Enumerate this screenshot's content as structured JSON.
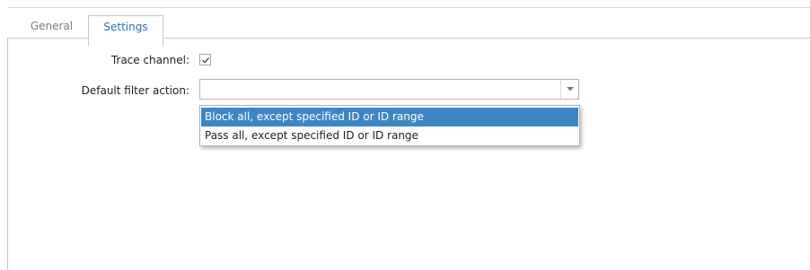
{
  "tabs": [
    {
      "label": "General",
      "selected": false
    },
    {
      "label": "Settings",
      "selected": true
    }
  ],
  "form": {
    "trace_channel_label": "Trace channel:",
    "trace_channel_checked": true,
    "default_filter_label": "Default filter action:",
    "default_filter_value": ""
  },
  "dropdown": {
    "options": [
      {
        "label": "Block all, except specified ID or ID range",
        "highlighted": true
      },
      {
        "label": "Pass all, except specified ID or ID range",
        "highlighted": false
      }
    ]
  },
  "colors": {
    "selected_tab_text": "#2f6fb5",
    "highlight": "#3d86c6",
    "border": "#c8c8c8"
  },
  "icons": {
    "checkbox_mark": "check-icon",
    "combo_arrow": "chevron-down-icon"
  }
}
